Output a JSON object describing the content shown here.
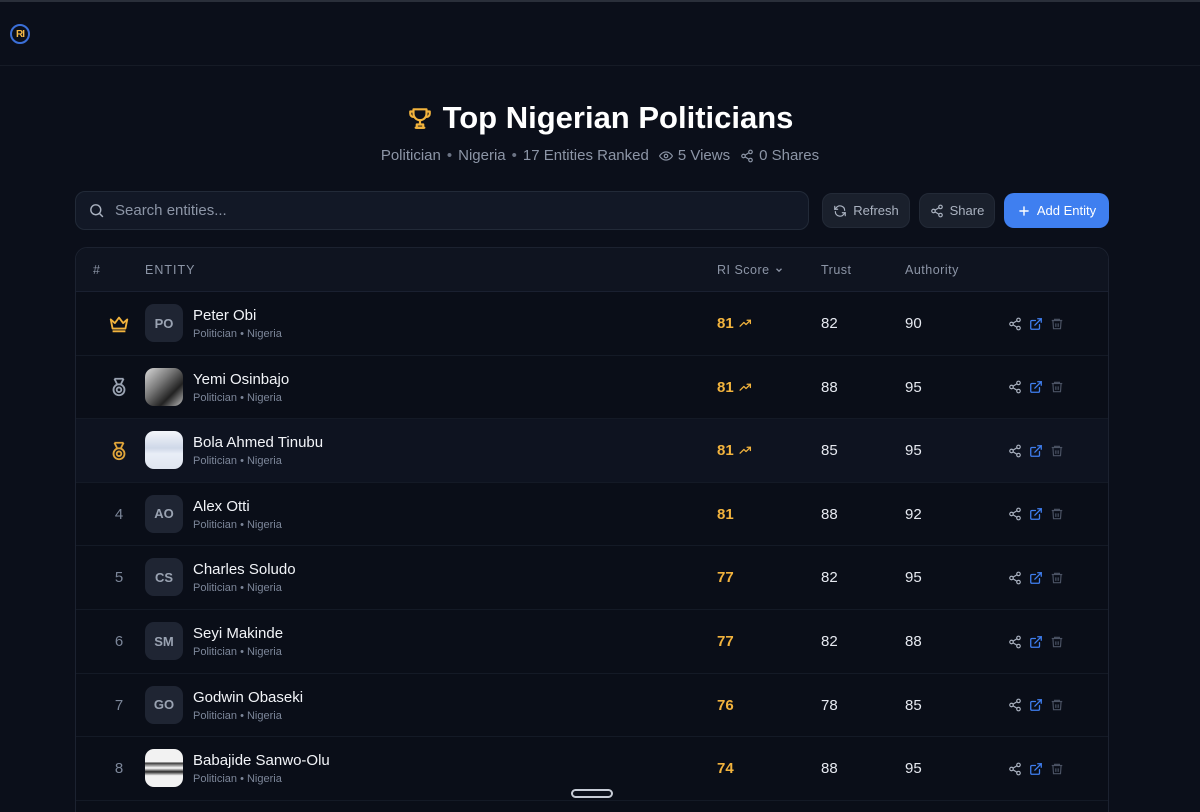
{
  "app": {
    "logo_text": "RI"
  },
  "header": {
    "title": "Top Nigerian Politicians",
    "category": "Politician",
    "country": "Nigeria",
    "count_text": "17 Entities Ranked",
    "views_text": "5 Views",
    "shares_text": "0 Shares",
    "separator": "•"
  },
  "search": {
    "placeholder": "Search entities...",
    "value": ""
  },
  "toolbar": {
    "refresh_label": "Refresh",
    "share_label": "Share",
    "add_label": "Add Entity"
  },
  "table": {
    "columns": {
      "rank": "#",
      "entity": "ENTITY",
      "score": "RI Score",
      "trust": "Trust",
      "authority": "Authority"
    },
    "rows": [
      {
        "rank": "1",
        "badge": "crown-icon",
        "initials": "PO",
        "name": "Peter Obi",
        "sub": "Politician • Nigeria",
        "score": "81",
        "trend": true,
        "trust": "82",
        "authority": "90"
      },
      {
        "rank": "2",
        "badge": "silver-medal-icon",
        "initials": "",
        "name": "Yemi Osinbajo",
        "sub": "Politician • Nigeria",
        "score": "81",
        "trend": true,
        "trust": "88",
        "authority": "95"
      },
      {
        "rank": "3",
        "badge": "bronze-medal-icon",
        "initials": "",
        "name": "Bola Ahmed Tinubu",
        "sub": "Politician • Nigeria",
        "score": "81",
        "trend": true,
        "trust": "85",
        "authority": "95"
      },
      {
        "rank": "4",
        "badge": "",
        "initials": "AO",
        "name": "Alex Otti",
        "sub": "Politician • Nigeria",
        "score": "81",
        "trend": false,
        "trust": "88",
        "authority": "92"
      },
      {
        "rank": "5",
        "badge": "",
        "initials": "CS",
        "name": "Charles Soludo",
        "sub": "Politician • Nigeria",
        "score": "77",
        "trend": false,
        "trust": "82",
        "authority": "95"
      },
      {
        "rank": "6",
        "badge": "",
        "initials": "SM",
        "name": "Seyi Makinde",
        "sub": "Politician • Nigeria",
        "score": "77",
        "trend": false,
        "trust": "82",
        "authority": "88"
      },
      {
        "rank": "7",
        "badge": "",
        "initials": "GO",
        "name": "Godwin Obaseki",
        "sub": "Politician • Nigeria",
        "score": "76",
        "trend": false,
        "trust": "78",
        "authority": "85"
      },
      {
        "rank": "8",
        "badge": "",
        "initials": "",
        "name": "Babajide Sanwo-Olu",
        "sub": "Politician • Nigeria",
        "score": "74",
        "trend": false,
        "trust": "88",
        "authority": "95"
      }
    ]
  },
  "colors": {
    "accent": "#3f7ff0",
    "score": "#f2b33d",
    "background": "#0b0f1a",
    "gold": "#f2b33d",
    "silver": "#9aa3b2"
  }
}
